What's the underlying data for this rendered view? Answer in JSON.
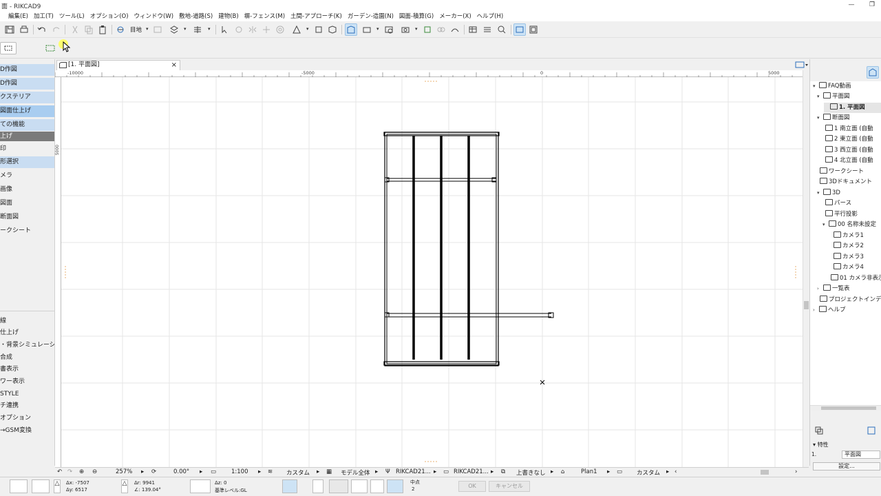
{
  "window": {
    "title": "面 - RIKCAD9",
    "min_label": "—",
    "max_label": "❐"
  },
  "menu": [
    "編集(E)",
    "加工(T)",
    "ツール(L)",
    "オプション(O)",
    "ウィンドウ(W)",
    "敷地-道路(S)",
    "建物(B)",
    "塀-フェンス(M)",
    "土間-アプローチ(K)",
    "ガーデン-造園(N)",
    "図面-積算(G)",
    "メーカー(X)",
    "ヘルプ(H)"
  ],
  "toolbar": {
    "view_label": "目地"
  },
  "left_panel": {
    "items": [
      "D作図",
      "D作図",
      "クステリア",
      "図面仕上げ",
      "ての機能",
      "上げ",
      "印",
      "形選択",
      "メラ",
      "画像",
      "図面",
      "断面図",
      "ークシート"
    ],
    "items2": [
      "線",
      "仕上げ",
      "・背景シミュレーシ…",
      "合成",
      "書表示",
      "ワー表示",
      "STYLE",
      "チ連携",
      "オプション",
      "→GSM変換"
    ]
  },
  "tab": {
    "label": "[1. 平面図]",
    "close": "×"
  },
  "ruler": {
    "labels": [
      "-10000",
      "-5000",
      "0",
      "5000"
    ],
    "vlabel": "5000"
  },
  "navigator": {
    "items": [
      {
        "label": "FAQ動画",
        "arrow": "▾"
      },
      {
        "label": "平面図",
        "arrow": "▾"
      },
      {
        "label": "1. 平面図",
        "arrow": ""
      },
      {
        "label": "断面図",
        "arrow": "▾"
      },
      {
        "label": "1 南立面 (自動",
        "arrow": ""
      },
      {
        "label": "2 東立面 (自動",
        "arrow": ""
      },
      {
        "label": "3 西立面 (自動",
        "arrow": ""
      },
      {
        "label": "4 北立面 (自動",
        "arrow": ""
      },
      {
        "label": "ワークシート",
        "arrow": ""
      },
      {
        "label": "3Dドキュメント",
        "arrow": ""
      },
      {
        "label": "3D",
        "arrow": "▾"
      },
      {
        "label": "パース",
        "arrow": ""
      },
      {
        "label": "平行投影",
        "arrow": ""
      },
      {
        "label": "00 名称未設定",
        "arrow": "▾"
      },
      {
        "label": "カメラ1",
        "arrow": ""
      },
      {
        "label": "カメラ2",
        "arrow": ""
      },
      {
        "label": "カメラ3",
        "arrow": ""
      },
      {
        "label": "カメラ4",
        "arrow": ""
      },
      {
        "label": "01 カメラ非表示",
        "arrow": ""
      },
      {
        "label": "一覧表",
        "arrow": "›"
      },
      {
        "label": "プロジェクトインデ",
        "arrow": ""
      },
      {
        "label": "ヘルプ",
        "arrow": "›"
      }
    ],
    "props_header": "特性",
    "props_id": "1.",
    "props_value": "平面図",
    "props_button": "設定..."
  },
  "status": {
    "zoom": "257%",
    "angle": "0.00°",
    "scale": "1:100",
    "layer_set": "カスタム",
    "model": "モデル全体",
    "pen1": "RIKCAD21...",
    "pen2": "RIKCAD21...",
    "override": "上書きなし",
    "plan": "Plan1",
    "custom2": "カスタム"
  },
  "info": {
    "dx": "Δx: -7507",
    "dy": "Δy: 6517",
    "dr": "Δr: 9941",
    "da": "∠: 139.04°",
    "dz": "Δz: 0",
    "ref": "基準レベル:GL",
    "snap_label": "中点",
    "snap_value": "2",
    "ok": "OK",
    "cancel": "キャンセル"
  }
}
